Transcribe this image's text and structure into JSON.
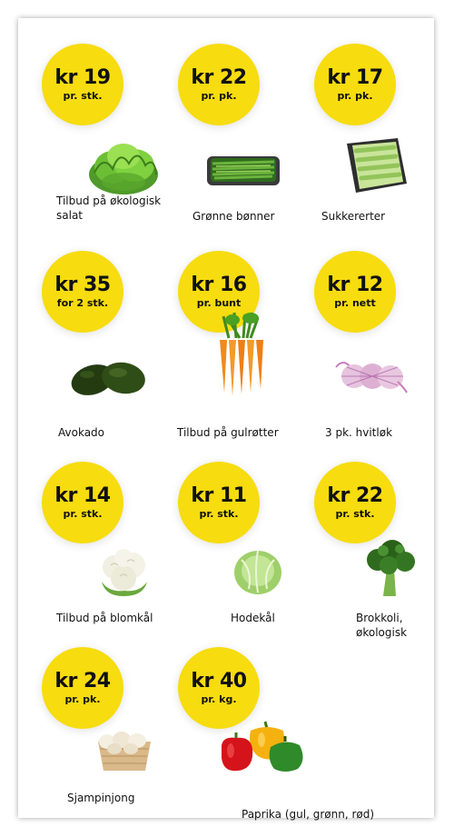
{
  "items": [
    {
      "price": "kr 19",
      "unit": "pr. stk.",
      "name": "Tilbud på økologisk salat",
      "icon": "lettuce-icon"
    },
    {
      "price": "kr 22",
      "unit": "pr. pk.",
      "name": "Grønne bønner",
      "icon": "green-beans-icon"
    },
    {
      "price": "kr 17",
      "unit": "pr. pk.",
      "name": "Sukkererter",
      "icon": "sugar-snap-peas-icon"
    },
    {
      "price": "kr 35",
      "unit": "for 2 stk.",
      "name": "Avokado",
      "icon": "avocado-icon"
    },
    {
      "price": "kr 16",
      "unit": "pr. bunt",
      "name": "Tilbud på gulrøtter",
      "icon": "carrots-icon"
    },
    {
      "price": "kr 12",
      "unit": "pr. nett",
      "name": "3 pk. hvitløk",
      "icon": "garlic-icon"
    },
    {
      "price": "kr 14",
      "unit": "pr. stk.",
      "name": "Tilbud på blomkål",
      "icon": "cauliflower-icon"
    },
    {
      "price": "kr 11",
      "unit": "pr. stk.",
      "name": "Hodekål",
      "icon": "cabbage-icon"
    },
    {
      "price": "kr 22",
      "unit": "pr. stk.",
      "name": "Brokkoli, økologisk",
      "icon": "broccoli-icon"
    },
    {
      "price": "kr 24",
      "unit": "pr. pk.",
      "name": "Sjampinjong",
      "icon": "mushrooms-icon"
    },
    {
      "price": "kr 40",
      "unit": "pr. kg.",
      "name": "Paprika (gul, grønn, rød)",
      "icon": "bell-peppers-icon"
    }
  ],
  "colors": {
    "badge": "#f7dc0f"
  }
}
